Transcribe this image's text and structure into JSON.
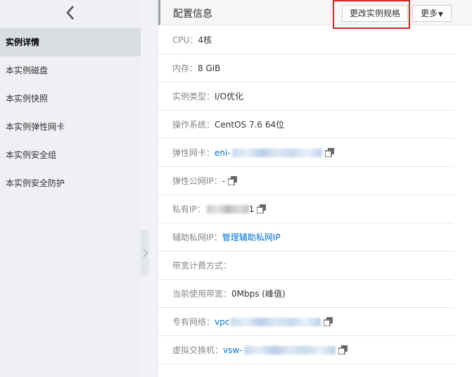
{
  "sidebar": {
    "items": [
      {
        "label": "实例详情",
        "active": true
      },
      {
        "label": "本实例磁盘"
      },
      {
        "label": "本实例快照"
      },
      {
        "label": "本实例弹性网卡"
      },
      {
        "label": "本实例安全组"
      },
      {
        "label": "本实例安全防护"
      }
    ]
  },
  "panel": {
    "title": "配置信息",
    "change_spec_label": "更改实例规格",
    "more_label": "更多"
  },
  "rows": {
    "cpu": {
      "key": "CPU：",
      "value": "4核"
    },
    "memory": {
      "key": "内存：",
      "value": "8 GiB"
    },
    "instance_type": {
      "key": "实例类型：",
      "value": "I/O优化"
    },
    "os": {
      "key": "操作系统：",
      "value": "CentOS 7.6 64位"
    },
    "eni": {
      "key": "弹性网卡：",
      "value": "eni-"
    },
    "eip": {
      "key": "弹性公网IP：",
      "value": "-"
    },
    "private_ip": {
      "key": "私有IP：",
      "value": "1"
    },
    "secondary_ip": {
      "key": "辅助私网IP：",
      "link": "管理辅助私网IP"
    },
    "billing": {
      "key": "带宽计费方式："
    },
    "bandwidth": {
      "key": "当前使用带宽：",
      "value": "0Mbps (峰值)"
    },
    "vpc": {
      "key": "专有网络：",
      "value": "vpc"
    },
    "vswitch": {
      "key": "虚拟交换机：",
      "value": "vsw-"
    }
  },
  "colors": {
    "link": "#0070cc",
    "highlight": "#d9262c",
    "sidebar_bg": "#eef0f3",
    "active_bg": "#d9dce1"
  }
}
